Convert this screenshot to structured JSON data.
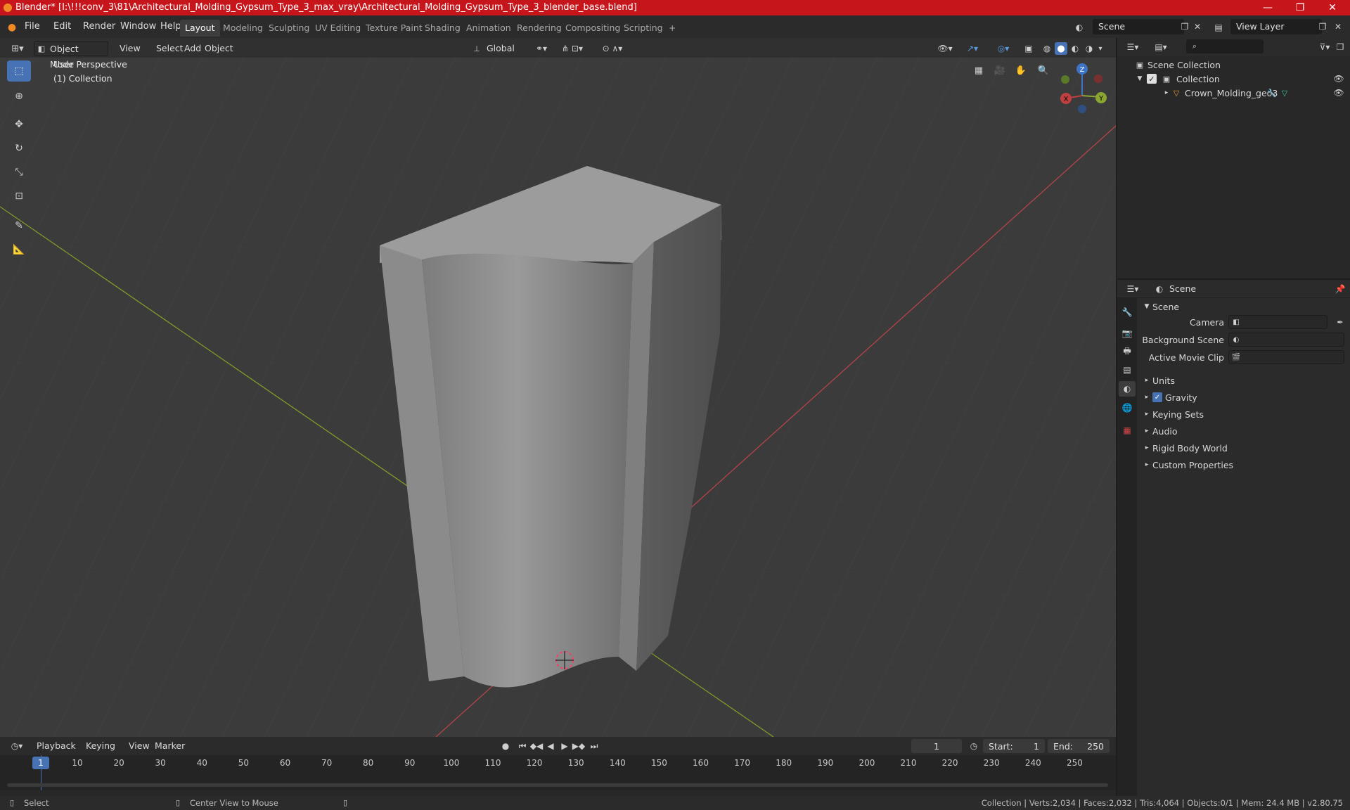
{
  "window": {
    "title": "Blender* [I:\\!!!conv_3\\81\\Architectural_Molding_Gypsum_Type_3_max_vray\\Architectural_Molding_Gypsum_Type_3_blender_base.blend]",
    "minimize": "—",
    "maximize": "❐",
    "close": "✕"
  },
  "menu": [
    "File",
    "Edit",
    "Render",
    "Window",
    "Help"
  ],
  "workspaces": [
    "Layout",
    "Modeling",
    "Sculpting",
    "UV Editing",
    "Texture Paint",
    "Shading",
    "Animation",
    "Rendering",
    "Compositing",
    "Scripting",
    "+"
  ],
  "active_workspace": "Layout",
  "scene_field": "Scene",
  "view_layer_field": "View Layer",
  "viewport": {
    "mode": "Object Mode",
    "menus": [
      "View",
      "Select",
      "Add",
      "Object"
    ],
    "orientation": "Global",
    "info_line1": "User Perspective",
    "info_line2": "(1) Collection",
    "gizmo": {
      "x": "X",
      "y": "Y",
      "z": "Z"
    }
  },
  "outliner": {
    "root": "Scene Collection",
    "collection": "Collection",
    "object": "Crown_Molding_geo3"
  },
  "properties": {
    "header": "Scene",
    "panel": "Scene",
    "fields": [
      {
        "label": "Camera",
        "value": ""
      },
      {
        "label": "Background Scene",
        "value": ""
      },
      {
        "label": "Active Movie Clip",
        "value": ""
      }
    ],
    "sections": [
      "Units",
      "Gravity",
      "Keying Sets",
      "Audio",
      "Rigid Body World",
      "Custom Properties"
    ],
    "gravity_checked": true
  },
  "timeline": {
    "menus": [
      "Playback",
      "Keying",
      "View",
      "Marker"
    ],
    "current_frame": "1",
    "start_label": "Start:",
    "start": "1",
    "end_label": "End:",
    "end": "250",
    "ticks": [
      "1",
      "10",
      "20",
      "30",
      "40",
      "50",
      "60",
      "70",
      "80",
      "90",
      "100",
      "110",
      "120",
      "130",
      "140",
      "150",
      "160",
      "170",
      "180",
      "190",
      "200",
      "210",
      "220",
      "230",
      "240",
      "250"
    ]
  },
  "status": {
    "left1": "Select",
    "left2": "Center View to Mouse",
    "right": "Collection | Verts:2,034 | Faces:2,032 | Tris:4,064 | Objects:0/1 | Mem: 24.4 MB | v2.80.75"
  },
  "colors": {
    "title_bar": "#c6161c",
    "accent": "#4772b3",
    "x_axis": "#c0403f",
    "y_axis": "#8aa630",
    "z_axis": "#3e74c8"
  }
}
